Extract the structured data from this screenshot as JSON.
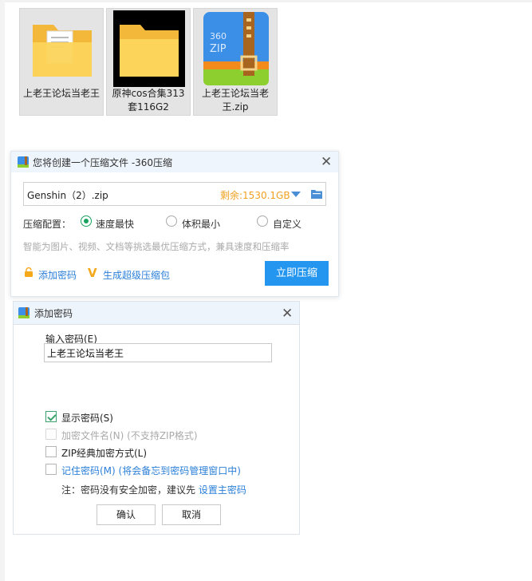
{
  "files": [
    {
      "name": "上老王论坛当老王",
      "icon": "folder-with-document-icon"
    },
    {
      "name": "原神cos合集313套116G2",
      "icon": "folder-icon"
    },
    {
      "name": "上老王论坛当老王.zip",
      "icon": "360zip-archive-icon"
    }
  ],
  "compress_dialog": {
    "title": "您将创建一个压缩文件 -360压缩",
    "filename": "Genshin（2）.zip",
    "remaining": "剩余:1530.1GB",
    "config_label": "压缩配置：",
    "options": [
      "速度最快",
      "体积最小",
      "自定义"
    ],
    "selected_option": "速度最快",
    "hint": "智能为图片、视频、文档等挑选最优压缩方式，兼具速度和压缩率",
    "add_password": "添加密码",
    "super_package": "生成超级压缩包",
    "compress_button": "立即压缩"
  },
  "password_dialog": {
    "title": "添加密码",
    "input_label": "输入密码(E)",
    "password_value": "上老王论坛当老王",
    "show_password": "显示密码(S)",
    "encrypt_filenames": "加密文件名(N)  (不支持ZIP格式)",
    "zip_classic": "ZIP经典加密方式(L)",
    "remember_password": "记住密码(M) (将会备忘到密码管理窗口中)",
    "note_prefix": "注：密码没有安全加密，建议先 ",
    "note_link": "设置主密码",
    "ok": "确认",
    "cancel": "取消"
  },
  "colors": {
    "accent": "#2496f0",
    "link": "#2b7fd8",
    "warning": "#f0a020",
    "check_green": "#3da36d"
  }
}
